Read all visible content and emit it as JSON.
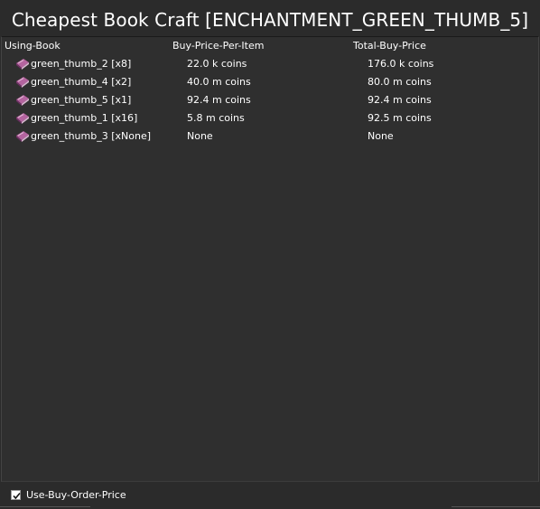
{
  "window": {
    "title": "Cheapest Book Craft [ENCHANTMENT_GREEN_THUMB_5]"
  },
  "table": {
    "columns": [
      "Using-Book",
      "Buy-Price-Per-Item",
      "Total-Buy-Price"
    ],
    "rows": [
      {
        "book": "green_thumb_2 [x8]",
        "price_per_item": "22.0 k coins",
        "total_price": "176.0 k coins"
      },
      {
        "book": "green_thumb_4 [x2]",
        "price_per_item": "40.0 m coins",
        "total_price": "80.0 m coins"
      },
      {
        "book": "green_thumb_5 [x1]",
        "price_per_item": "92.4 m coins",
        "total_price": "92.4 m coins"
      },
      {
        "book": "green_thumb_1 [x16]",
        "price_per_item": "5.8 m coins",
        "total_price": "92.5 m coins"
      },
      {
        "book": "green_thumb_3 [xNone]",
        "price_per_item": "None",
        "total_price": "None"
      }
    ],
    "row_icon": "enchanted-book-icon"
  },
  "footer": {
    "use_buy_order_label": "Use-Buy-Order-Price",
    "use_buy_order_checked": true
  },
  "colors": {
    "background": "#2b2b2b",
    "text": "#ffffff",
    "book_icon": "#9b4f8f"
  }
}
